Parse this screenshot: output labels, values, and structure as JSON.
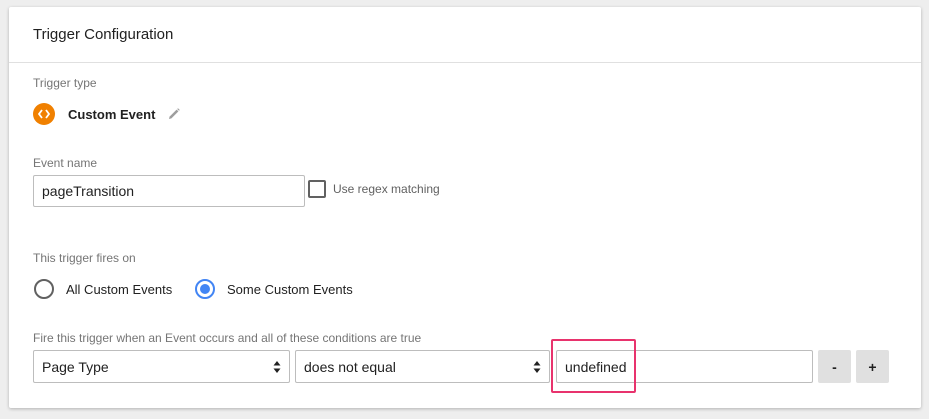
{
  "header": {
    "title": "Trigger Configuration"
  },
  "trigger_type": {
    "label": "Trigger type",
    "name": "Custom Event"
  },
  "event_name": {
    "label": "Event name",
    "value": "pageTransition",
    "regex_label": "Use regex matching"
  },
  "fires_on": {
    "label": "This trigger fires on",
    "options": [
      {
        "label": "All Custom Events",
        "checked": false
      },
      {
        "label": "Some Custom Events",
        "checked": true
      }
    ]
  },
  "conditions": {
    "label": "Fire this trigger when an Event occurs and all of these conditions are true",
    "variable": "Page Type",
    "operator": "does not equal",
    "value": "undefined",
    "remove_label": "-",
    "add_label": "+"
  },
  "colors": {
    "type_icon": "#f08000",
    "radio_checked": "#4285f4",
    "highlight": "#e8336d"
  }
}
